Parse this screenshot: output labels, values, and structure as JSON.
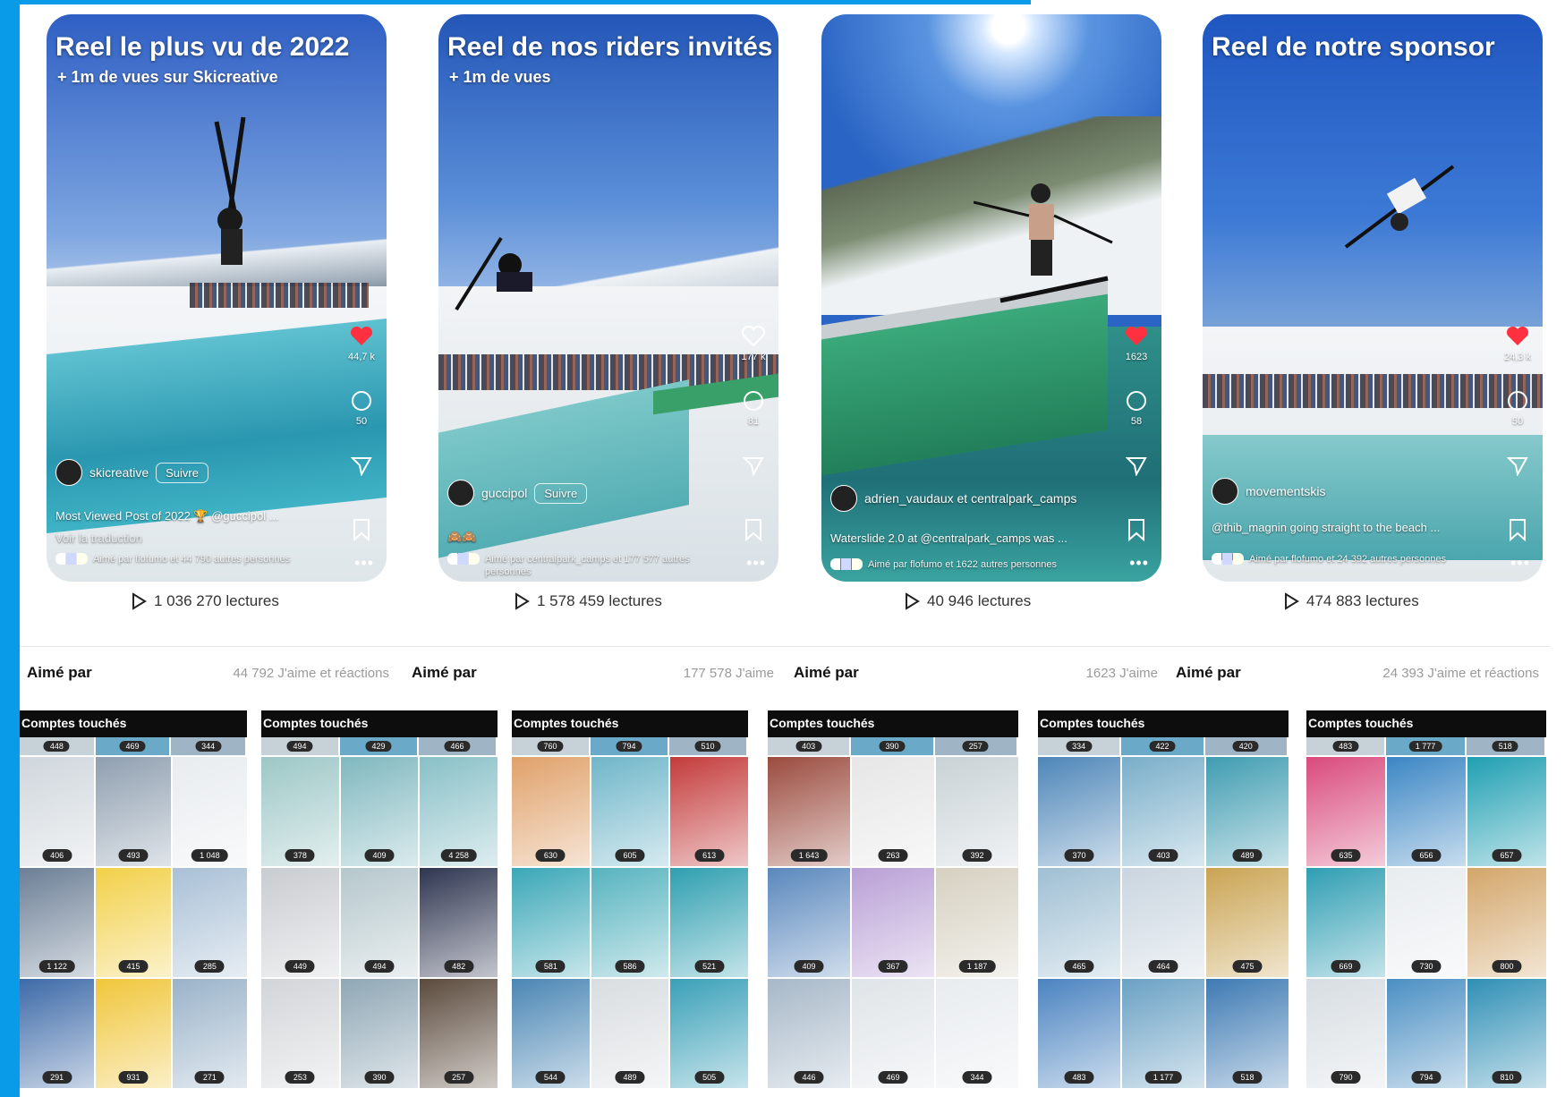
{
  "colors": {
    "accent": "#0a9be8",
    "heart": "#ff3040"
  },
  "reels": [
    {
      "title": "Reel le plus vu de 2022",
      "subtitle": "+ 1m de vues sur Skicreative",
      "account": "skicreative",
      "follow": "Suivre",
      "caption": "Most Viewed Post of 2022 🏆 @guccipol ...",
      "translate": "Voir la traduction",
      "liked_by": "Aimé par flofumo et 44 790 autres personnes",
      "like_count": "44,7 k",
      "comment_count": "50",
      "liked": true,
      "views": "1 036 270 lectures",
      "likes_total": "44 792 J'aime et réactions"
    },
    {
      "title": "Reel de nos riders invités",
      "subtitle": "+ 1m de vues",
      "account": "guccipol",
      "follow": "Suivre",
      "caption": "🙈🙈",
      "translate": "",
      "liked_by": "Aimé par centralpark_camps et 177 577 autres personnes",
      "like_count": "177 k",
      "comment_count": "81",
      "liked": false,
      "views": "1 578 459 lectures",
      "likes_total": "177 578 J'aime"
    },
    {
      "title": "",
      "subtitle": "",
      "account": "adrien_vaudaux et centralpark_camps",
      "follow": "",
      "caption": "Waterslide 2.0 at @centralpark_camps was ...",
      "translate": "",
      "liked_by": "Aimé par flofumo et 1622 autres personnes",
      "like_count": "1623",
      "comment_count": "58",
      "liked": true,
      "views": "40 946 lectures",
      "likes_total": "1623 J'aime"
    },
    {
      "title": "Reel de notre sponsor",
      "subtitle": "",
      "account": "movementskis",
      "follow": "",
      "caption": "@thib_magnin going straight to the beach ...",
      "translate": "",
      "liked_by": "Aimé par flofumo et 24 392 autres personnes",
      "like_count": "24,3 k",
      "comment_count": "50",
      "liked": true,
      "views": "474 883 lectures",
      "likes_total": "24 393 J'aime et réactions"
    }
  ],
  "aime_par_label": "Aimé par",
  "grids": [
    {
      "title": "Comptes touchés",
      "strip": [
        "448",
        "469",
        "344"
      ],
      "counts": [
        "406",
        "493",
        "1 048",
        "1 122",
        "415",
        "285",
        "291",
        "931",
        "271"
      ]
    },
    {
      "title": "Comptes touchés",
      "strip": [
        "494",
        "429",
        "466"
      ],
      "counts": [
        "378",
        "409",
        "4 258",
        "449",
        "494",
        "482",
        "253",
        "390",
        "257"
      ]
    },
    {
      "title": "Comptes touchés",
      "strip": [
        "760",
        "794",
        "510"
      ],
      "counts": [
        "630",
        "605",
        "613",
        "581",
        "586",
        "521",
        "544",
        "489",
        "505"
      ]
    },
    {
      "title": "Comptes touchés",
      "strip": [
        "403",
        "390",
        "257"
      ],
      "counts": [
        "1 643",
        "263",
        "392",
        "409",
        "367",
        "1 187",
        "446",
        "469",
        "344"
      ]
    },
    {
      "title": "Comptes touchés",
      "strip": [
        "334",
        "422",
        "420"
      ],
      "counts": [
        "370",
        "403",
        "489",
        "465",
        "464",
        "475",
        "483",
        "1 177",
        "518"
      ]
    },
    {
      "title": "Comptes touchés",
      "strip": [
        "483",
        "1 777",
        "518"
      ],
      "counts": [
        "635",
        "656",
        "657",
        "669",
        "730",
        "800",
        "790",
        "794",
        "810"
      ]
    }
  ]
}
